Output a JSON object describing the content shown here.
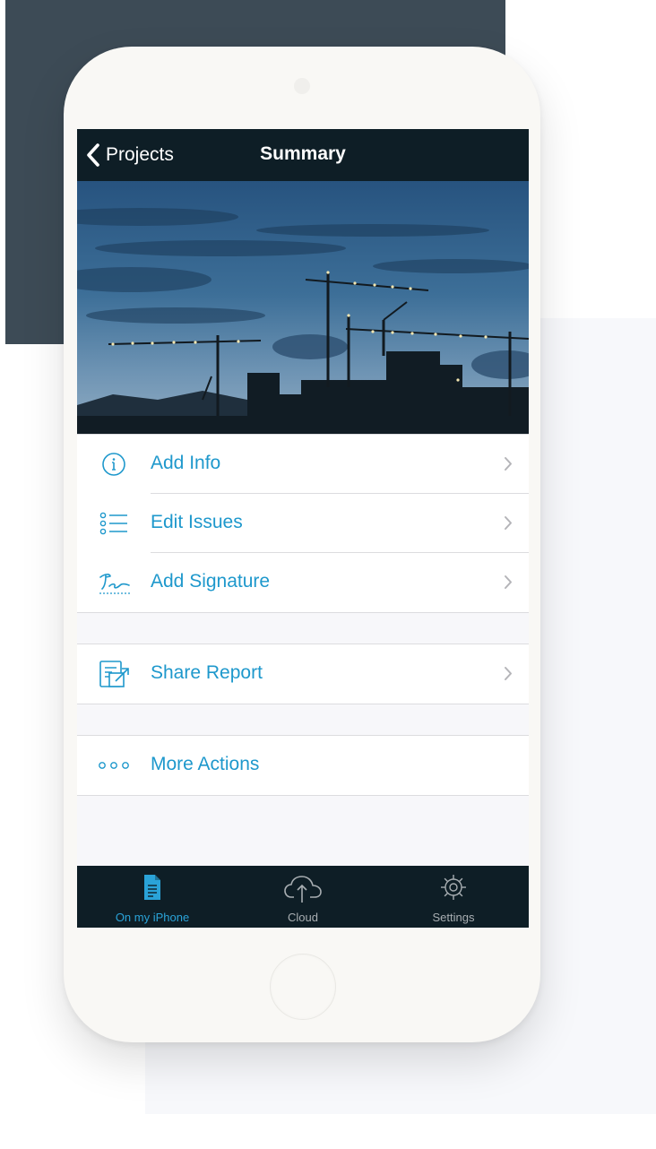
{
  "navbar": {
    "back_label": "Projects",
    "title": "Summary"
  },
  "summary_items": [
    {
      "label": "Add Info",
      "icon": "info-icon"
    },
    {
      "label": "Edit Issues",
      "icon": "list-icon"
    },
    {
      "label": "Add Signature",
      "icon": "signature-icon"
    }
  ],
  "share": {
    "label": "Share Report",
    "icon": "share-report-icon"
  },
  "more": {
    "label": "More Actions",
    "icon": "more-icon"
  },
  "tabs": [
    {
      "label": "On my iPhone",
      "icon": "document-icon",
      "active": true
    },
    {
      "label": "Cloud",
      "icon": "cloud-icon",
      "active": false
    },
    {
      "label": "Settings",
      "icon": "gear-icon",
      "active": false
    }
  ],
  "colors": {
    "accent": "#1e98cc",
    "navbar": "#0e1e26",
    "tab_active": "#2aa3d8"
  }
}
